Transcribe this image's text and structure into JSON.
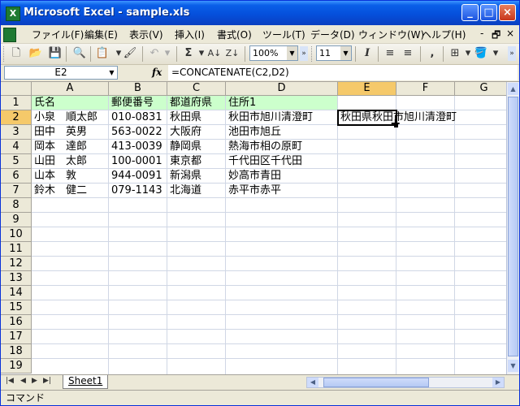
{
  "window": {
    "title": "Microsoft Excel - sample.xls",
    "icon_letter": "X",
    "minimize_icon": "minimize-icon",
    "maximize_icon": "maximize-icon",
    "close_icon": "close-icon"
  },
  "menu": {
    "items": [
      "ファイル(F)",
      "編集(E)",
      "表示(V)",
      "挿入(I)",
      "書式(O)",
      "ツール(T)",
      "データ(D)",
      "ウィンドウ(W)",
      "ヘルプ(H)"
    ],
    "mdi_min": "-",
    "mdi_restore": "🗗",
    "mdi_close": "×"
  },
  "toolbar": {
    "zoom": "100%",
    "font_size": "11",
    "sigma": "Σ",
    "italic": "I"
  },
  "formula_bar": {
    "name_box": "E2",
    "fx": "fx",
    "formula": "=CONCATENATE(C2,D2)"
  },
  "sheet": {
    "columns": [
      "A",
      "B",
      "C",
      "D",
      "E",
      "F",
      "G"
    ],
    "active_column": "E",
    "active_row": "2",
    "rows": [
      "1",
      "2",
      "3",
      "4",
      "5",
      "6",
      "7",
      "8",
      "9",
      "10",
      "11",
      "12",
      "13",
      "14",
      "15",
      "16",
      "17",
      "18",
      "19"
    ],
    "header_row": [
      "氏名",
      "郵便番号",
      "都道府県",
      "住所1"
    ],
    "data": [
      [
        "小泉　順太郎",
        "010-0831",
        "秋田県",
        "秋田市旭川清澄町"
      ],
      [
        "田中　英男",
        "563-0022",
        "大阪府",
        "池田市旭丘"
      ],
      [
        "岡本　達郎",
        "413-0039",
        "静岡県",
        "熱海市相の原町"
      ],
      [
        "山田　太郎",
        "100-0001",
        "東京都",
        "千代田区千代田"
      ],
      [
        "山本　敦",
        "944-0091",
        "新潟県",
        "妙高市青田"
      ],
      [
        "鈴木　健二",
        "079-1143",
        "北海道",
        "赤平市赤平"
      ]
    ],
    "e2_value": "秋田県秋田市旭川清澄町",
    "header_fill_color": "#ccffcc"
  },
  "tabs": {
    "nav": [
      "|◀",
      "◀",
      "▶",
      "▶|"
    ],
    "active": "Sheet1"
  },
  "status": {
    "text": "コマンド"
  }
}
